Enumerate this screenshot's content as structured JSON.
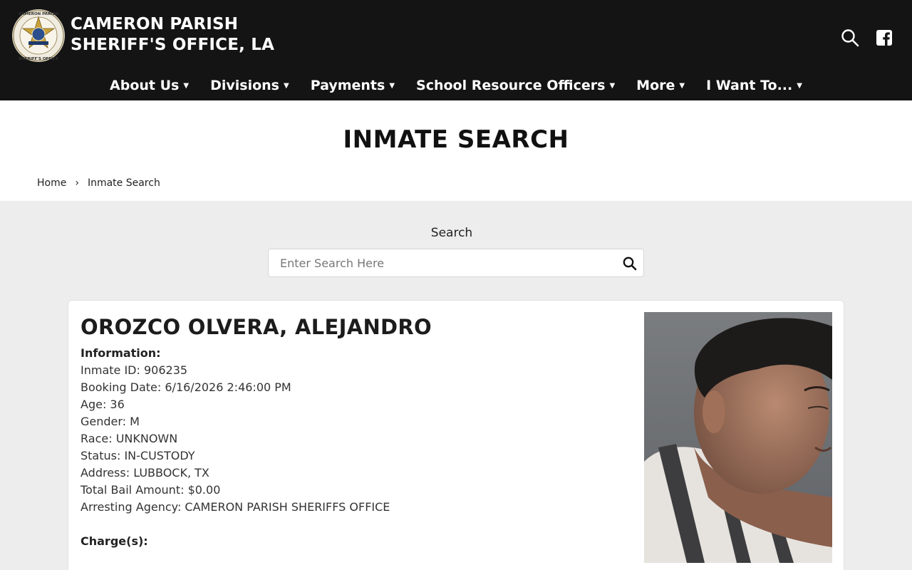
{
  "header": {
    "title_line1": "CAMERON PARISH",
    "title_line2": "SHERIFF'S OFFICE, LA",
    "logo": {
      "top_text": "CAMERON PARISH",
      "bottom_text": "SHERIFF'S OFFICE"
    },
    "icons": [
      "search-icon",
      "facebook-icon"
    ]
  },
  "nav": [
    {
      "label": "About Us"
    },
    {
      "label": "Divisions"
    },
    {
      "label": "Payments"
    },
    {
      "label": "School Resource Officers"
    },
    {
      "label": "More"
    },
    {
      "label": "I Want To..."
    }
  ],
  "page": {
    "title": "INMATE SEARCH",
    "breadcrumb": [
      "Home",
      "Inmate Search"
    ]
  },
  "search": {
    "label": "Search",
    "placeholder": "Enter Search Here"
  },
  "inmate": {
    "name": "OROZCO OLVERA, ALEJANDRO",
    "info_heading": "Information:",
    "fields": [
      "Inmate ID: 906235",
      "Booking Date: 6/16/2026 2:46:00 PM",
      "Age: 36",
      "Gender: M",
      "Race: UNKNOWN",
      "Status: IN-CUSTODY",
      "Address: LUBBOCK, TX",
      "Total Bail Amount: $0.00",
      "Arresting Agency: CAMERON PARISH SHERIFFS OFFICE"
    ],
    "charges_heading": "Charge(s):"
  },
  "colors": {
    "header_bg": "#141414",
    "page_bg": "#ededed",
    "badge_gold": "#c9a23a"
  }
}
